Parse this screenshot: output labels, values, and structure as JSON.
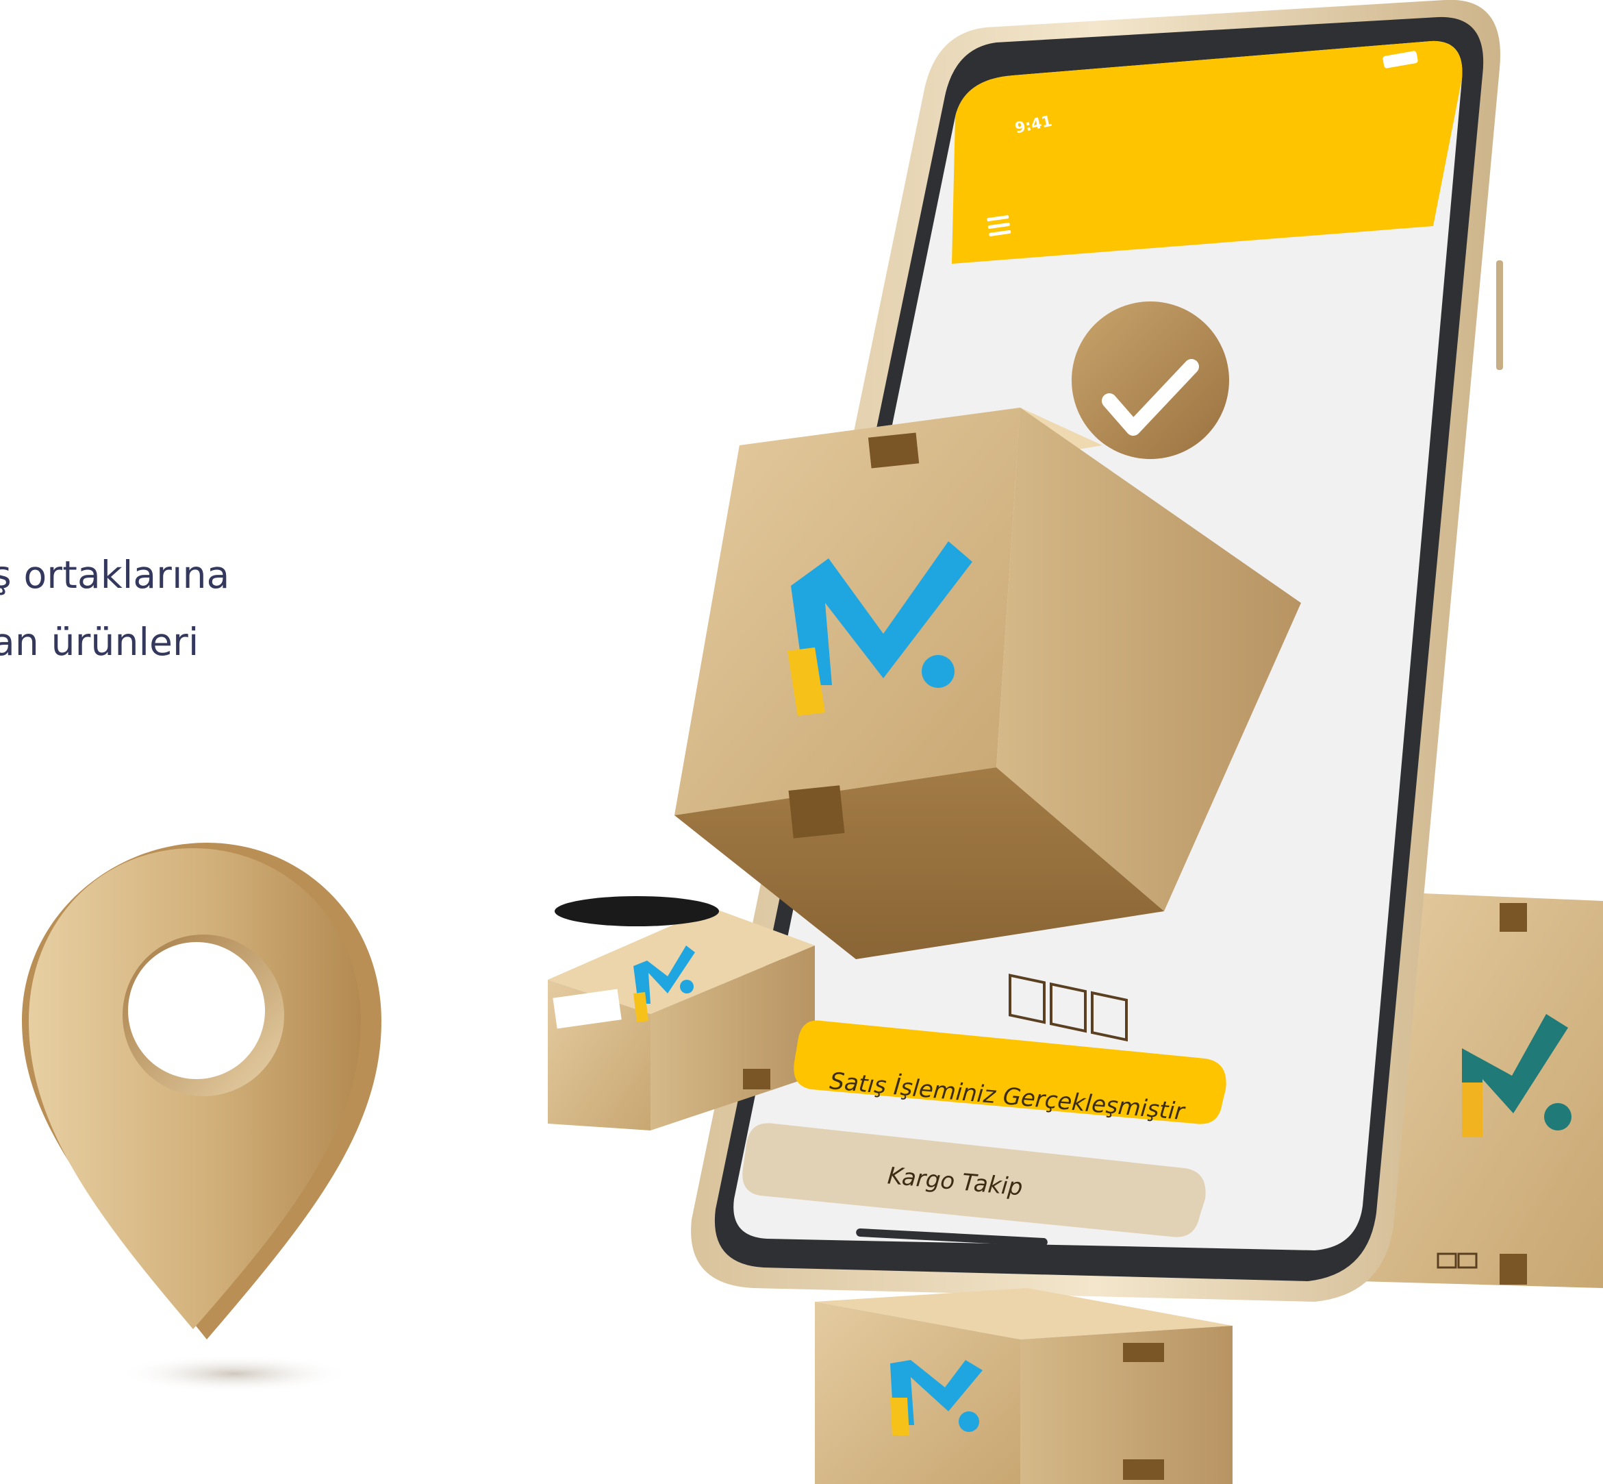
{
  "hero": {
    "headline_line1": "ş ortaklarına",
    "headline_line2": "an ürünleri"
  },
  "phone": {
    "status_time": "9:41",
    "accent_color": "#ffc400",
    "screen_bg": "#f1f1f1",
    "frame_color": "#2e3033",
    "body_color": "#ead6b2"
  },
  "screen": {
    "primary_button_label": "Satış İşleminiz Gerçekleşmiştir",
    "secondary_button_label": "Kargo Takip",
    "menu_icon": "hamburger-menu-icon",
    "success_icon": "checkmark-icon"
  },
  "brand": {
    "logo_colors": {
      "blue": "#1fa6e0",
      "yellow": "#f6c21a",
      "teal": "#1f7a78"
    },
    "box_color": "#d6b98a",
    "pin_color": "#c9a468"
  }
}
